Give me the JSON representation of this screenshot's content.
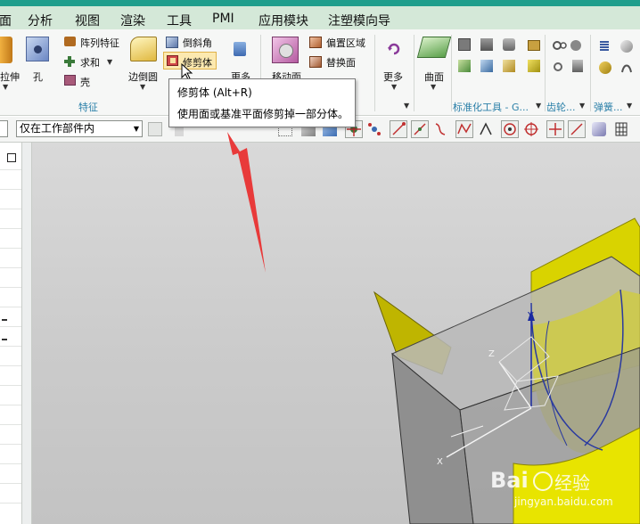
{
  "menu": {
    "items": [
      "面",
      "分析",
      "视图",
      "渲染",
      "工具",
      "PMI",
      "应用模块",
      "注塑模向导"
    ]
  },
  "ribbon": {
    "feature_group": {
      "label": "特征",
      "extrude_label": "拉伸",
      "hole_label": "孔",
      "pattern_feature_label": "阵列特征",
      "unite_label": "求和",
      "shell_label": "壳",
      "edge_blend_label": "边倒圆",
      "chamfer_label": "倒斜角",
      "trim_body_label": "修剪体",
      "more_label": "更多"
    },
    "sync_group": {
      "move_face_label": "移动面",
      "offset_region_label": "偏置区域",
      "replace_face_label": "替换面",
      "more_label": "更多"
    },
    "surface_label": "曲面",
    "standard_parts_label": "标准化工具 - G...",
    "gear_label": "齿轮...",
    "spring_label": "弹簧..."
  },
  "toolbar": {
    "left_combo_value": "",
    "scope_combo_value": "仅在工作部件内"
  },
  "tooltip": {
    "title": "修剪体 (Alt+R)",
    "description": "使用面或基准平面修剪掉一部分体。"
  },
  "viewport": {
    "axis_y": "Y",
    "axis_z": "Z",
    "axis_x": "X"
  },
  "watermark": {
    "brand": "Bai",
    "brand_suffix": "经验",
    "url": "jingyan.baidu.com"
  },
  "colors": {
    "title_accent": "#1f9e8c",
    "menubar_bg": "#d4e8d8",
    "group_label": "#2a7fa8",
    "annotation_arrow": "#e83a3a",
    "solid_yellow": "#d8d200"
  }
}
